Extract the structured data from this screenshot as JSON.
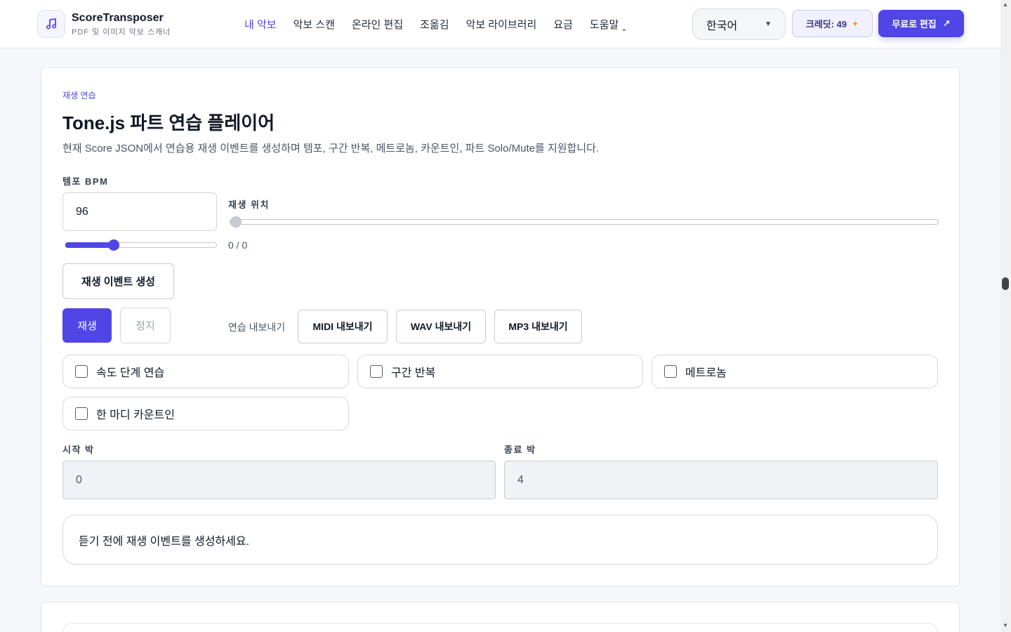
{
  "header": {
    "brand_name": "ScoreTransposer",
    "brand_sub": "PDF 및 이미지 악보 스캐너",
    "nav": [
      {
        "label": "내 악보",
        "active": true
      },
      {
        "label": "악보 스캔"
      },
      {
        "label": "온라인 편집"
      },
      {
        "label": "조옮김"
      },
      {
        "label": "악보 라이브러리"
      },
      {
        "label": "요금"
      },
      {
        "label": "도움말"
      }
    ],
    "language": "한국어",
    "credits": "크레딧: 49",
    "cta": "무료로 편집",
    "accent": "#4f46e5"
  },
  "player": {
    "eyebrow": "재생 연습",
    "title": "Tone.js 파트 연습 플레이어",
    "description": "현재 Score JSON에서 연습용 재생 이벤트를 생성하며 템포, 구간 반복, 메트로놈, 카운트인, 파트 Solo/Mute를 지원합니다.",
    "tempo_label": "템포 BPM",
    "tempo_value": "96",
    "tempo_slider_fraction": 0.32,
    "position_label": "재생 위치",
    "position_fraction": 0,
    "position_counter": "0 / 0",
    "generate_button": "재생 이벤트 생성",
    "play_button": "재생",
    "stop_button": "정지",
    "export_label": "연습 내보내기",
    "export_midi": "MIDI 내보내기",
    "export_wav": "WAV 내보내기",
    "export_mp3": "MP3 내보내기",
    "options": {
      "speed_steps": "속도 단계 연습",
      "loop": "구간 반복",
      "metronome": "메트로놈",
      "count_in": "한 마디 카운트인"
    },
    "start_beat_label": "시작 박",
    "start_beat_value": "0",
    "end_beat_label": "종료 박",
    "end_beat_value": "4",
    "status_message": "듣기 전에 재생 이벤트를 생성하세요."
  }
}
